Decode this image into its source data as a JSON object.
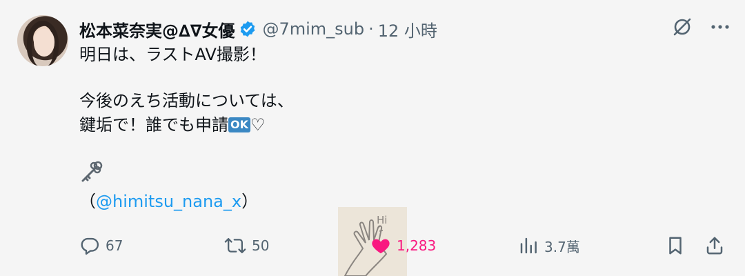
{
  "tweet": {
    "author_name": "松本菜奈実@∆∇女優",
    "handle": "@7mim_sub",
    "separator": "·",
    "time": "12 小時",
    "lines": [
      "明日は、ラストAV撮影！",
      "今後のえち活動については、",
      "鍵垢で！誰でも申請"
    ],
    "ok_emoji": "OK",
    "heart_emoji": "♡",
    "mention_open": "（",
    "mention": "@himitsu_nana_x",
    "mention_close": "）"
  },
  "actions": {
    "replies": "67",
    "retweets": "50",
    "likes": "1,283",
    "views": "3.7萬"
  },
  "sticker_text": "Hi",
  "colors": {
    "like": "#f91880",
    "link": "#1d9bf0",
    "muted": "#536471",
    "verified": "#1d9bf0"
  }
}
